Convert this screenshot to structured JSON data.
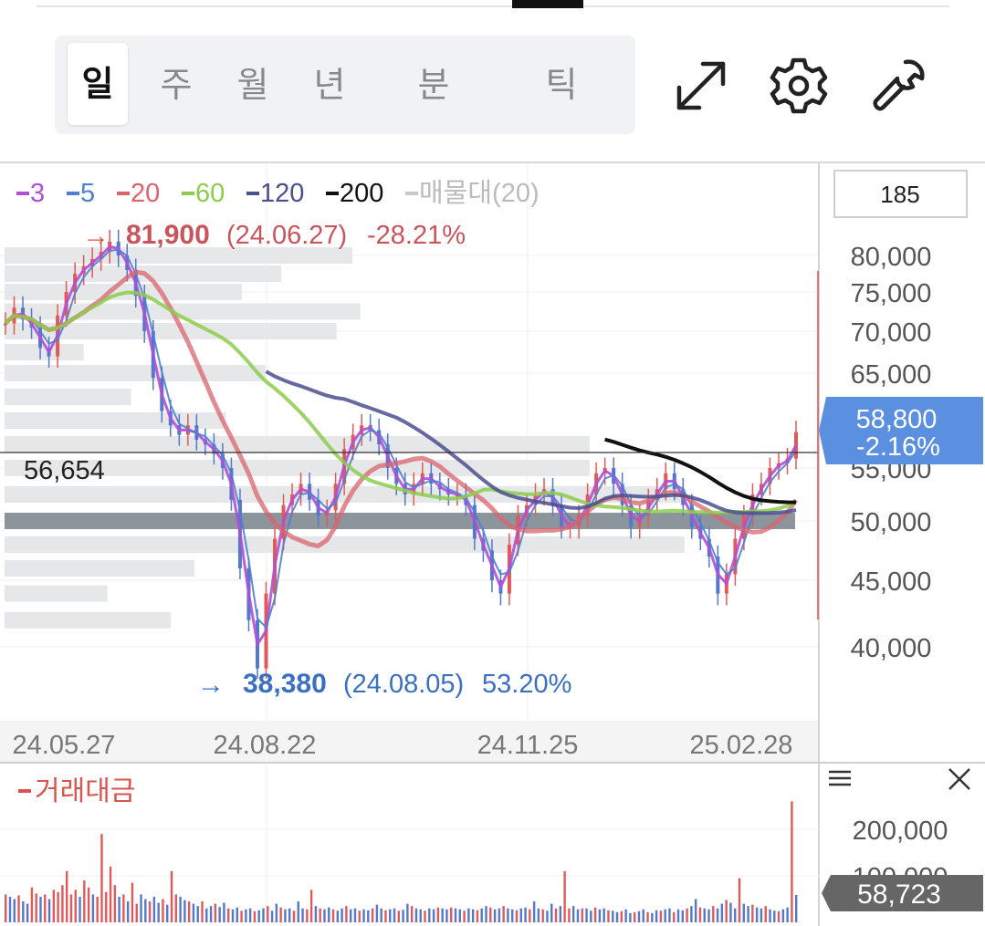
{
  "tabs": [
    {
      "label": "일",
      "active": true
    },
    {
      "label": "주",
      "active": false
    },
    {
      "label": "월",
      "active": false
    },
    {
      "label": "년",
      "active": false
    },
    {
      "label": "분",
      "active": false
    },
    {
      "label": "틱",
      "active": false
    }
  ],
  "toolbar": {
    "expand": "expand-icon",
    "settings": "gear-icon",
    "tools": "wrench-icon"
  },
  "period_input": "185",
  "legend": [
    {
      "label": "3",
      "color": "#b04fd6"
    },
    {
      "label": "5",
      "color": "#4f7fd0"
    },
    {
      "label": "20",
      "color": "#d9646e"
    },
    {
      "label": "60",
      "color": "#8ccc4e"
    },
    {
      "label": "120",
      "color": "#4a4f8e"
    },
    {
      "label": "200",
      "color": "#111111"
    },
    {
      "label": "매물대(20)",
      "color": "#c8c8c8"
    }
  ],
  "high_marker": {
    "arrow": "→",
    "value": "81,900",
    "date": "(24.06.27)",
    "pct": "-28.21%"
  },
  "low_marker": {
    "arrow": "→",
    "value": "38,380",
    "date": "(24.08.05)",
    "pct": "53.20%"
  },
  "crosshair_value": "56,654",
  "current_price": {
    "value": "58,800",
    "change": "-2.16%"
  },
  "volume_title": "거래대금",
  "volume_current": "58,723",
  "chart_data": {
    "type": "line",
    "price_axis": {
      "ticks": [
        80000,
        75000,
        70000,
        65000,
        55000,
        50000,
        45000,
        40000
      ],
      "labels": [
        "80,000",
        "75,000",
        "70,000",
        "65,000",
        "55,000",
        "50,000",
        "45,000",
        "40,000"
      ]
    },
    "x_labels": [
      "24.05.27",
      "24.08.22",
      "24.11.25",
      "25.02.28"
    ],
    "ylim": [
      38000,
      82500
    ],
    "close_series": [
      71000,
      73000,
      71500,
      70500,
      68000,
      67000,
      72000,
      75000,
      77500,
      78500,
      79500,
      80500,
      81900,
      80000,
      78000,
      74500,
      70000,
      64500,
      61000,
      59500,
      58500,
      59500,
      58000,
      57500,
      56500,
      55000,
      52000,
      46000,
      42000,
      38380,
      44000,
      48500,
      51500,
      52500,
      53500,
      52000,
      50500,
      51000,
      53500,
      57000,
      58500,
      59500,
      59000,
      57500,
      55000,
      53500,
      52500,
      53500,
      54500,
      53500,
      53000,
      52500,
      52500,
      51500,
      48500,
      47500,
      45000,
      44000,
      48000,
      50500,
      51500,
      52500,
      53000,
      51500,
      49500,
      49500,
      50500,
      52500,
      54500,
      55000,
      53500,
      51500,
      49500,
      50500,
      52000,
      53000,
      54500,
      53000,
      51500,
      49500,
      48500,
      47000,
      44000,
      45500,
      48500,
      50500,
      52500,
      53500,
      55000,
      55500,
      56000,
      58800
    ],
    "ma_values": {
      "ma20": [
        65000,
        78000,
        62000,
        50500,
        53000,
        48500,
        51000,
        52000
      ],
      "ma60": [
        56500,
        65000,
        56000,
        52500,
        51800,
        51200,
        51500
      ],
      "ma120": [
        57500,
        58000,
        52500,
        52000
      ],
      "ma200": [
        56800,
        56600
      ]
    },
    "volume_profile": [
      {
        "price": 80000,
        "rel": 0.44
      },
      {
        "price": 77500,
        "rel": 0.35
      },
      {
        "price": 75000,
        "rel": 0.3
      },
      {
        "price": 72500,
        "rel": 0.45
      },
      {
        "price": 70000,
        "rel": 0.42
      },
      {
        "price": 67500,
        "rel": 0.1
      },
      {
        "price": 65000,
        "rel": 0.33
      },
      {
        "price": 62500,
        "rel": 0.16
      },
      {
        "price": 60000,
        "rel": 0.28
      },
      {
        "price": 57500,
        "rel": 0.74
      },
      {
        "price": 55000,
        "rel": 0.74
      },
      {
        "price": 52500,
        "rel": 0.86
      },
      {
        "price": 50000,
        "rel": 1.0
      },
      {
        "price": 48000,
        "rel": 0.86
      },
      {
        "price": 46000,
        "rel": 0.24
      },
      {
        "price": 44000,
        "rel": 0.13
      },
      {
        "price": 42000,
        "rel": 0.21
      }
    ],
    "volume": {
      "axis_ticks": [
        200000,
        100000
      ],
      "axis_labels": [
        "200,000",
        "100,000"
      ],
      "values": [
        60000,
        55000,
        50000,
        58000,
        45000,
        40000,
        75000,
        62000,
        55000,
        60000,
        50000,
        70000,
        65000,
        80000,
        110000,
        60000,
        70000,
        55000,
        90000,
        75000,
        60000,
        55000,
        190000,
        65000,
        120000,
        80000,
        55000,
        60000,
        45000,
        85000,
        40000,
        60000,
        50000,
        45000,
        55000,
        42000,
        50000,
        38000,
        110000,
        60000,
        55000,
        48000,
        45000,
        40000,
        35000,
        45000,
        30000,
        35000,
        40000,
        33000,
        42000,
        30000,
        28000,
        32000,
        25000,
        28000,
        30000,
        24000,
        26000,
        30000,
        35000,
        25000,
        40000,
        32000,
        28000,
        30000,
        25000,
        45000,
        30000,
        28000,
        70000,
        35000,
        30000,
        28000,
        32000,
        28000,
        25000,
        30000,
        35000,
        28000,
        30000,
        25000,
        28000,
        26000,
        30000,
        38000,
        30000,
        26000,
        28000,
        30000,
        25000,
        27000,
        40000,
        35000,
        30000,
        28000,
        25000,
        30000,
        28000,
        32000,
        30000,
        28000,
        32000,
        30000,
        28000,
        25000,
        30000,
        28000,
        26000,
        30000,
        35000,
        32000,
        28000,
        30000,
        35000,
        30000,
        28000,
        26000,
        30000,
        32000,
        28000,
        45000,
        30000,
        28000,
        25000,
        40000,
        30000,
        35000,
        110000,
        30000,
        35000,
        28000,
        30000,
        30000,
        25000,
        32000,
        28000,
        30000,
        26000,
        25000,
        22000,
        24000,
        28000,
        20000,
        22000,
        24000,
        28000,
        22000,
        20000,
        26000,
        25000,
        28000,
        30000,
        22000,
        28000,
        26000,
        30000,
        35000,
        50000,
        32000,
        30000,
        28000,
        35000,
        30000,
        40000,
        48000,
        42000,
        30000,
        95000,
        40000,
        35000,
        38000,
        32000,
        30000,
        35000,
        28000,
        25000,
        24000,
        28000,
        32000,
        260000,
        58723
      ]
    }
  }
}
